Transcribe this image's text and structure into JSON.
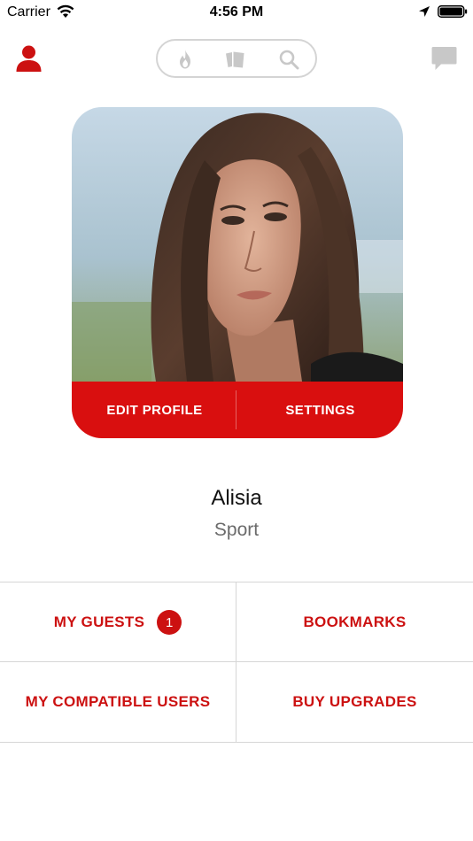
{
  "status_bar": {
    "carrier": "Carrier",
    "time": "4:56 PM"
  },
  "nav": {
    "profile_icon": "person-icon",
    "pill_icons": [
      "fire-icon",
      "cards-icon",
      "search-icon"
    ],
    "chat_icon": "chat-bubble-icon"
  },
  "profile": {
    "edit_label": "EDIT PROFILE",
    "settings_label": "SETTINGS",
    "name": "Alisia",
    "status": "Sport"
  },
  "menu": {
    "guests_label": "MY GUESTS",
    "guests_count": "1",
    "bookmarks_label": "BOOKMARKS",
    "compatible_label": "MY COMPATIBLE USERS",
    "upgrades_label": "BUY UPGRADES"
  },
  "colors": {
    "accent": "#cc1111",
    "card_bar": "#d90f0f",
    "muted_icon": "#c8c8c8"
  }
}
